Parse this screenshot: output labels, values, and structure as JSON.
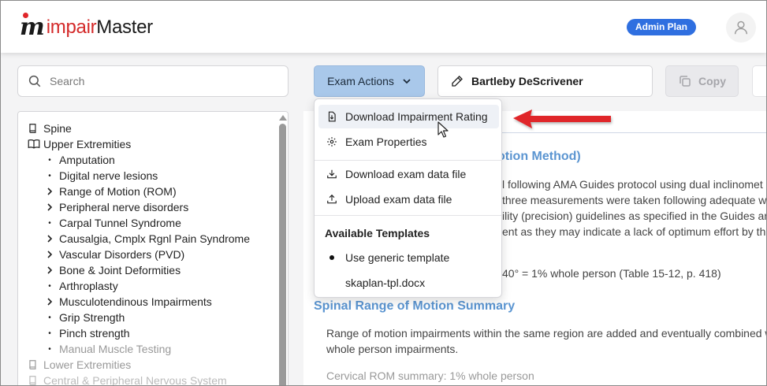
{
  "app": {
    "logo_prefix": "impair",
    "logo_suffix": "Master",
    "plan_badge": "Admin Plan"
  },
  "search": {
    "placeholder": "Search"
  },
  "tree": {
    "items": [
      {
        "label": "Spine",
        "type": "root",
        "icon": "book-icon"
      },
      {
        "label": "Upper Extremities",
        "type": "root",
        "icon": "book-open-icon"
      },
      {
        "label": "Amputation",
        "type": "leaf"
      },
      {
        "label": "Digital nerve lesions",
        "type": "leaf"
      },
      {
        "label": "Range of Motion (ROM)",
        "type": "branch"
      },
      {
        "label": "Peripheral nerve disorders",
        "type": "branch"
      },
      {
        "label": "Carpal Tunnel Syndrome",
        "type": "leaf"
      },
      {
        "label": "Causalgia, Cmplx Rgnl Pain Syndrome",
        "type": "branch"
      },
      {
        "label": "Vascular Disorders (PVD)",
        "type": "branch"
      },
      {
        "label": "Bone & Joint Deformities",
        "type": "branch"
      },
      {
        "label": "Arthroplasty",
        "type": "leaf"
      },
      {
        "label": "Musculotendinous Impairments",
        "type": "branch"
      },
      {
        "label": "Grip Strength",
        "type": "leaf"
      },
      {
        "label": "Pinch strength",
        "type": "leaf"
      },
      {
        "label": "Manual Muscle Testing",
        "type": "leaf"
      },
      {
        "label": "Lower Extremities",
        "type": "root",
        "icon": "book-icon"
      },
      {
        "label": "Central & Peripheral Nervous System",
        "type": "root",
        "icon": "book-icon"
      }
    ]
  },
  "toolbar": {
    "exam_actions": "Exam Actions",
    "author": "Bartleby DeScrivener",
    "copy": "Copy"
  },
  "dropdown": {
    "download_rating": "Download Impairment Rating",
    "exam_properties": "Exam Properties",
    "download_data": "Download exam data file",
    "upload_data": "Upload exam data file",
    "templates_heading": "Available Templates",
    "template_generic": "Use generic template",
    "template_file": "skaplan-tpl.docx"
  },
  "document": {
    "heading1_fragment": "otion Method)",
    "p1_line1": "l following AMA Guides protocol using dual inclinomet",
    "p1_line2": "three measurements were taken following adequate wa",
    "p1_line3": "ility (precision) guidelines as specified in the Guides are",
    "p1_line4": "ent as they may indicate a lack of optimum effort by th",
    "p2_fragment": "40° = 1% whole person (Table 15-12, p. 418)",
    "heading2": "Spinal Range of Motion Summary",
    "p3_line1": "Range of motion impairments within the same region are added and eventually combined w",
    "p3_line2": "whole person impairments.",
    "p4_fragment": "Cervical ROM summary: 1% whole person"
  },
  "colors": {
    "brand_red": "#d42a2a",
    "badge_blue": "#2f6fe0",
    "exam_actions_bg": "#a9c8ea",
    "heading_blue": "#5b95d1",
    "annotation_red": "#e0262a"
  }
}
